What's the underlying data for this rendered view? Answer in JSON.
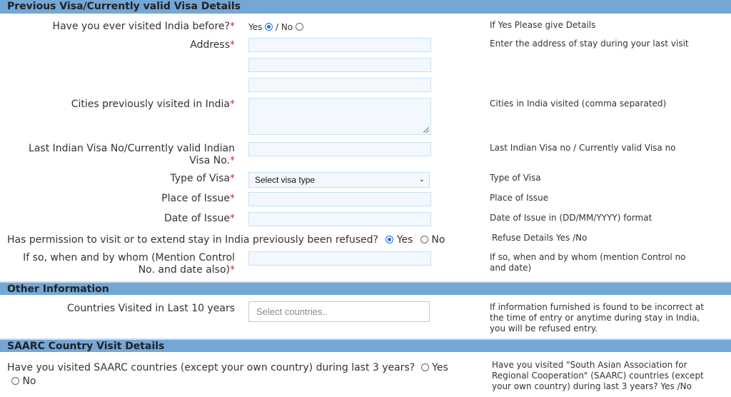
{
  "sections": {
    "previous_visa": "Previous Visa/Currently valid Visa Details",
    "other_info": "Other Information",
    "saarc": "SAARC Country Visit Details"
  },
  "visited_before": {
    "label": "Have you ever visited India before?",
    "yes": "Yes",
    "separator": "/ No",
    "selected": "Yes",
    "help": "If Yes Please give Details"
  },
  "address": {
    "label": "Address",
    "line1": "",
    "line2": "",
    "line3": "",
    "help": "Enter the address of stay during your last visit"
  },
  "cities": {
    "label": "Cities previously visited in India",
    "value": "",
    "help": "Cities in India visited (comma separated)"
  },
  "visa_no": {
    "label_line1": "Last Indian Visa No/Currently valid Indian",
    "label_line2": "Visa No.",
    "value": "",
    "help": "Last Indian Visa no / Currently valid Visa no"
  },
  "visa_type": {
    "label": "Type of Visa",
    "selected": "Select visa type",
    "help": "Type of Visa"
  },
  "place_of_issue": {
    "label": "Place of Issue",
    "value": "",
    "help": "Place of Issue"
  },
  "date_of_issue": {
    "label": "Date of Issue",
    "value": "",
    "help": "Date of Issue in (DD/MM/YYYY) format"
  },
  "refused": {
    "label": "Has permission to visit or to extend stay in India previously been refused?",
    "yes": "Yes",
    "no": "No",
    "selected": "Yes",
    "help": "Refuse Details Yes /No"
  },
  "refused_details": {
    "label_line1": "If so, when and by whom (Mention Control",
    "label_line2": "No. and date also)",
    "value": "",
    "help": "If so, when and by whom (mention Control no and date)"
  },
  "countries_visited": {
    "label": "Countries Visited in Last 10 years",
    "placeholder": "Select countries..",
    "help": "If information furnished is found to be incorrect at the time of entry or anytime during stay in India, you will be refused entry."
  },
  "saarc_visit": {
    "label": "Have you visited SAARC countries (except your own country) during last 3 years?",
    "yes": "Yes",
    "no": "No",
    "selected": null,
    "help": "Have you visited \"South Asian Association for Regional Cooperation\" (SAARC) countries (except your own country) during last 3 years? Yes /No"
  },
  "required_marker": "*",
  "colors": {
    "section_header_bg": "#74a7d6",
    "input_bg": "#f3f8fe",
    "input_border": "#c6e0f5",
    "required": "#c0392b",
    "radio_checked": "#1a73e8"
  }
}
